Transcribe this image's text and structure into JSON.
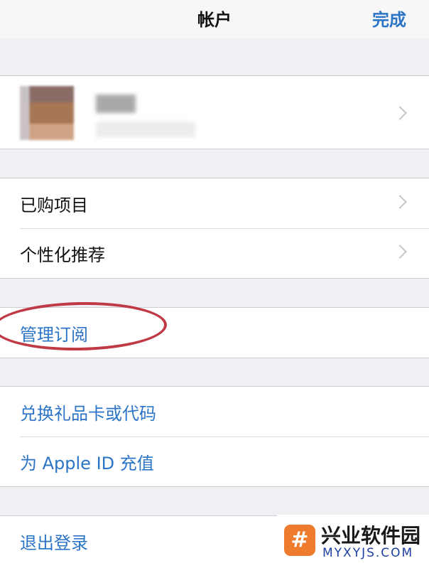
{
  "navbar": {
    "title": "帐户",
    "done_label": "完成"
  },
  "menu": {
    "purchased": "已购项目",
    "personalized": "个性化推荐",
    "manage_subscriptions": "管理订阅",
    "redeem": "兑换礼品卡或代码",
    "add_funds": "为 Apple ID 充值",
    "sign_out": "退出登录"
  },
  "colors": {
    "link": "#2b74c6",
    "annotation_circle": "#c03a45",
    "background": "#efeff4"
  },
  "watermark": {
    "logo_glyph": "#",
    "name": "兴业软件园",
    "url": "MYXYJS.COM"
  }
}
